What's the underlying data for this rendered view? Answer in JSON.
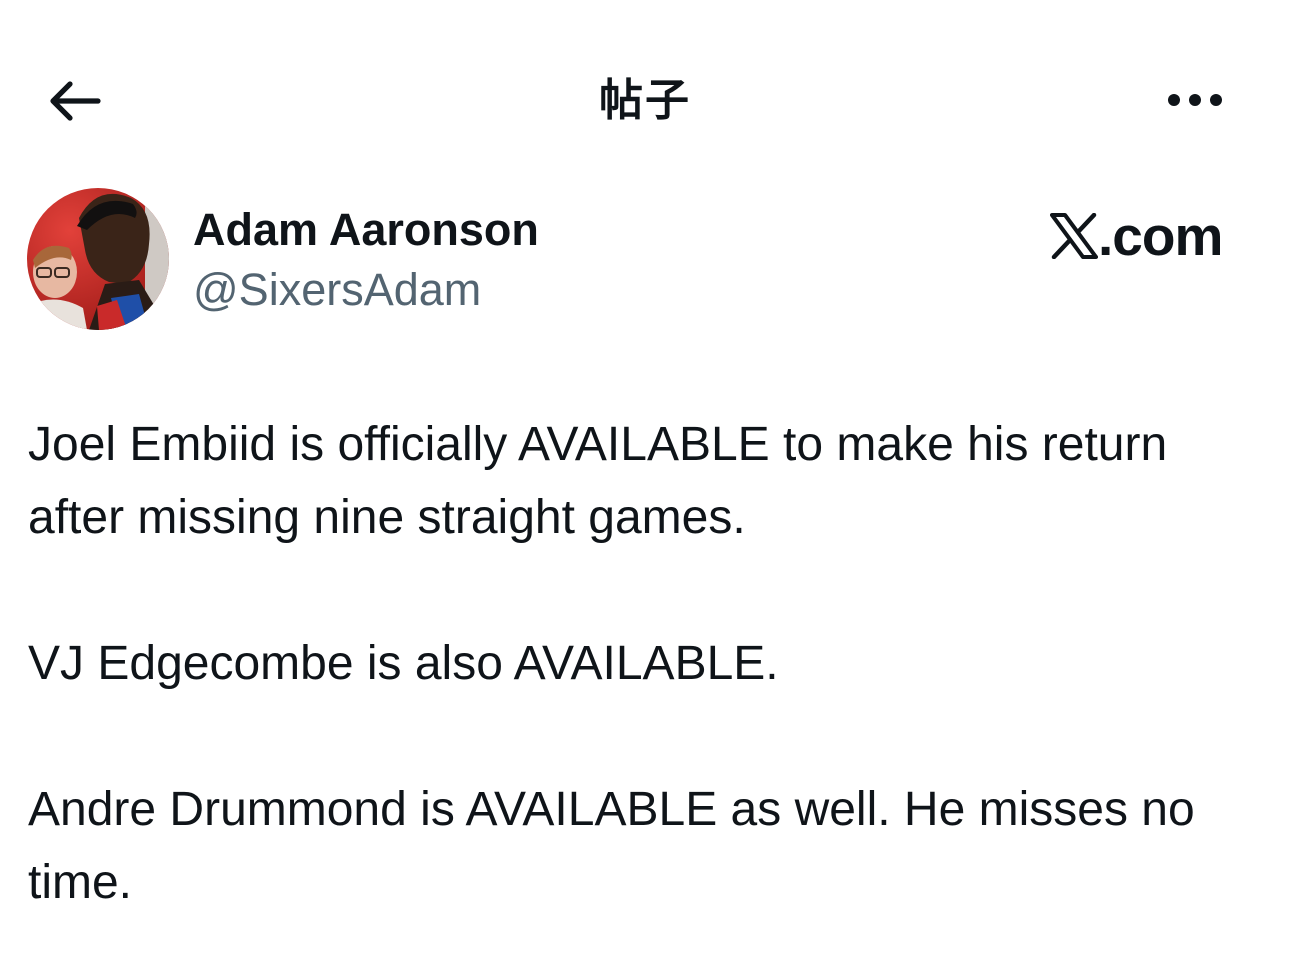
{
  "header": {
    "title": "帖子",
    "back_icon": "arrow-left-icon",
    "more_icon": "more-horizontal-icon"
  },
  "author": {
    "display_name": "Adam Aaronson",
    "handle": "@SixersAdam"
  },
  "source_badge": {
    "text": ".com",
    "logo": "X"
  },
  "tweet": {
    "paragraphs": [
      "Joel Embiid is officially AVAILABLE to make his return after missing nine straight games.",
      "VJ Edgecombe is also AVAILABLE.",
      "Andre Drummond is AVAILABLE as well. He misses no time."
    ]
  },
  "colors": {
    "text_primary": "#0f1419",
    "text_secondary": "#536471",
    "background": "#ffffff"
  }
}
